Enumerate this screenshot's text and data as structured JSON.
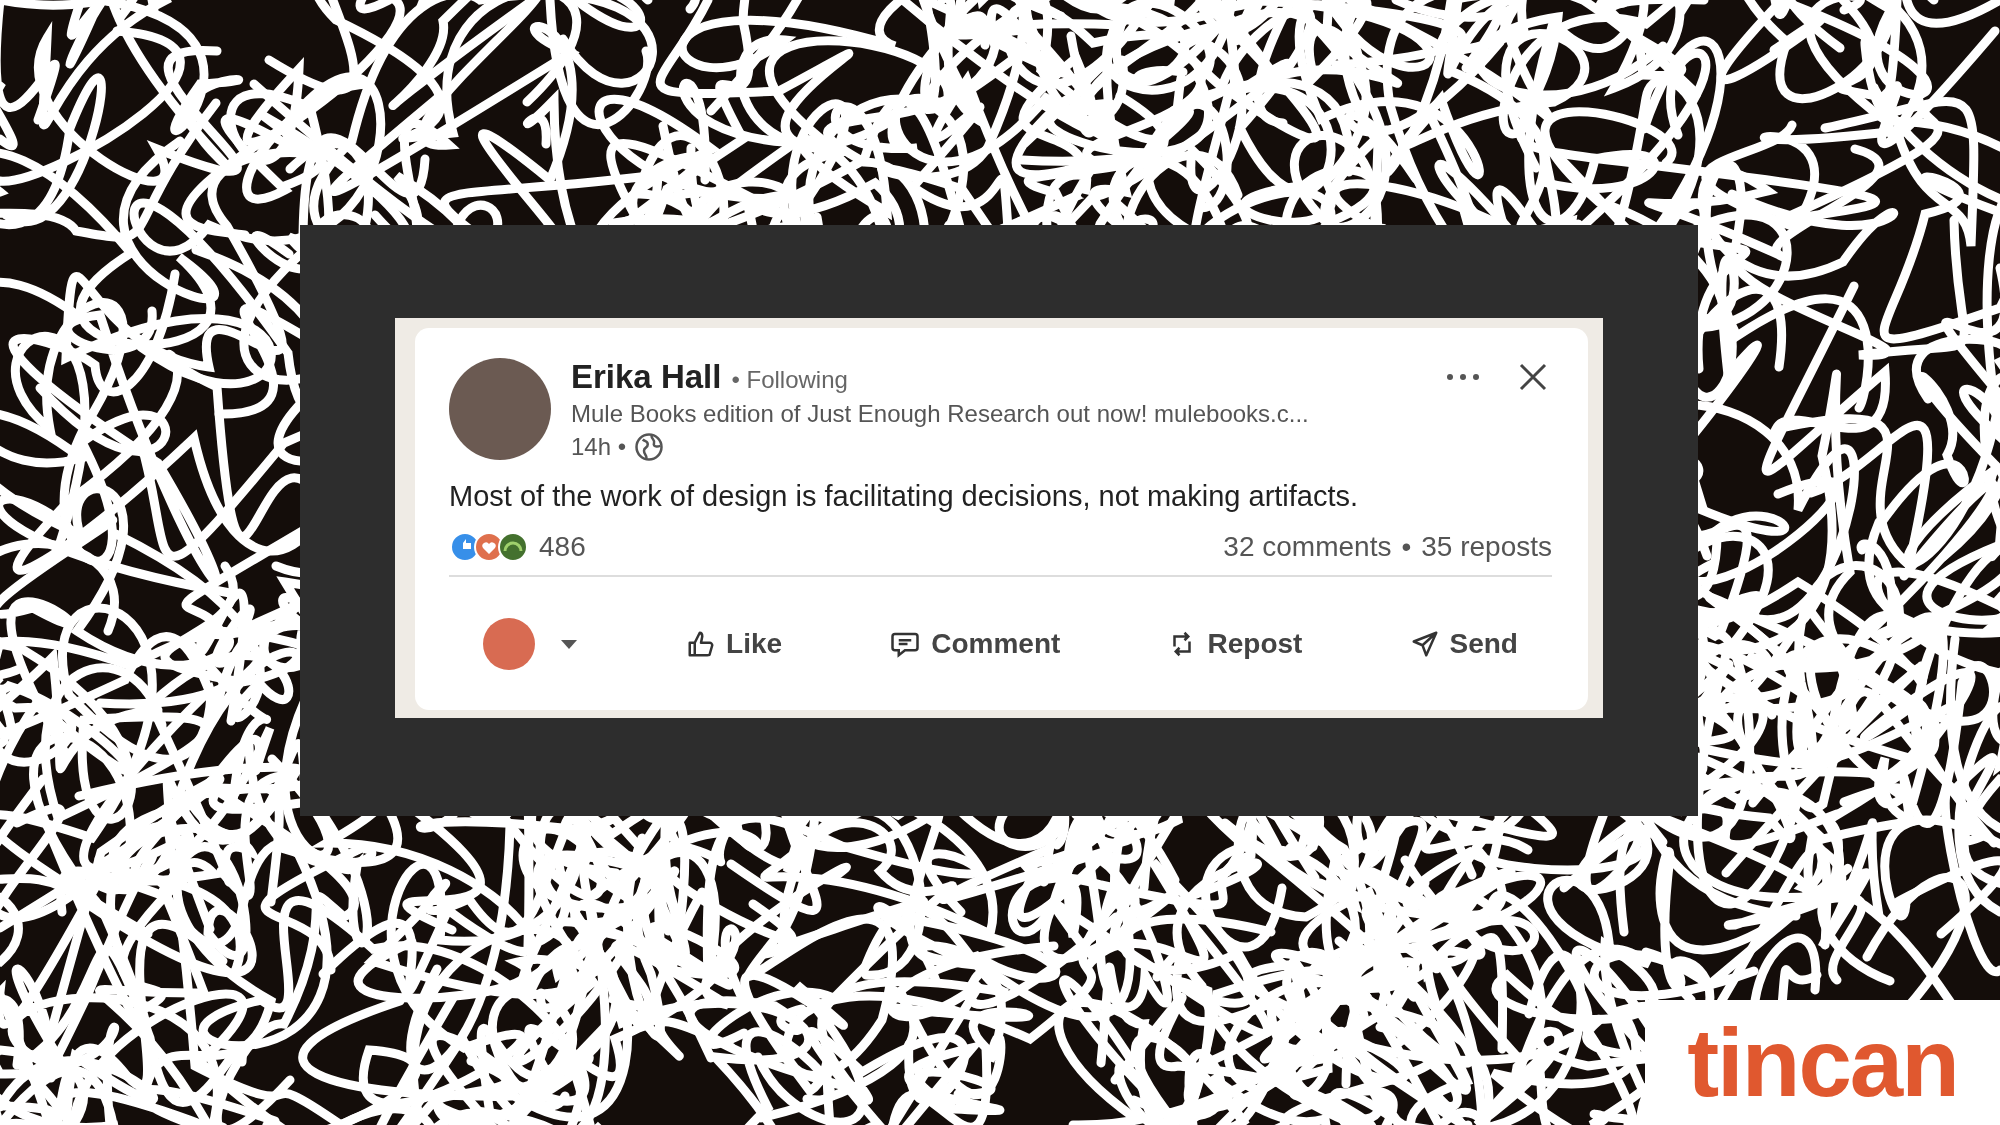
{
  "post": {
    "author": "Erika Hall",
    "relation": "• Following",
    "headline": "Mule Books edition of Just Enough Research out now! mulebooks.c...",
    "time": "14h •",
    "text": "Most of the work of design is facilitating decisions, not making artifacts.",
    "reaction_count": "486",
    "stats": [
      "32 comments",
      "35 reposts"
    ],
    "stats_separator": "•",
    "actions": [
      {
        "kind": "identity"
      },
      {
        "kind": "like",
        "label": "Like"
      },
      {
        "kind": "comment",
        "label": "Comment"
      },
      {
        "kind": "repost",
        "label": "Repost"
      },
      {
        "kind": "send",
        "label": "Send"
      }
    ]
  },
  "logo": "tincan"
}
